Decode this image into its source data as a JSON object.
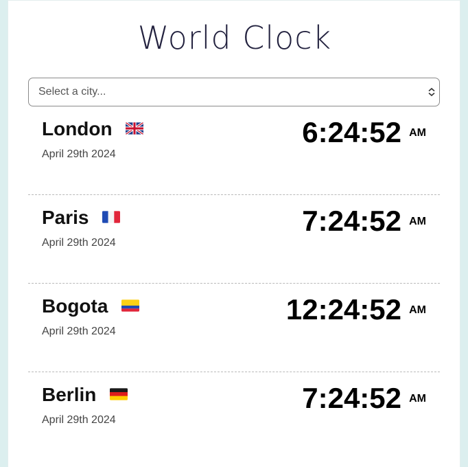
{
  "app": {
    "title": "World Clock"
  },
  "city_select": {
    "placeholder": "Select a city..."
  },
  "clocks": [
    {
      "city": "London",
      "flag": "uk-flag-icon",
      "date": "April 29th 2024",
      "time": "6:24:52",
      "ampm": "AM"
    },
    {
      "city": "Paris",
      "flag": "france-flag-icon",
      "date": "April 29th 2024",
      "time": "7:24:52",
      "ampm": "AM"
    },
    {
      "city": "Bogota",
      "flag": "colombia-flag-icon",
      "date": "April 29th 2024",
      "time": "12:24:52",
      "ampm": "AM"
    },
    {
      "city": "Berlin",
      "flag": "germany-flag-icon",
      "date": "April 29th 2024",
      "time": "7:24:52",
      "ampm": "AM"
    }
  ],
  "colors": {
    "background": "#dcefef",
    "title": "#23223f",
    "divider": "#b9b9b9"
  }
}
